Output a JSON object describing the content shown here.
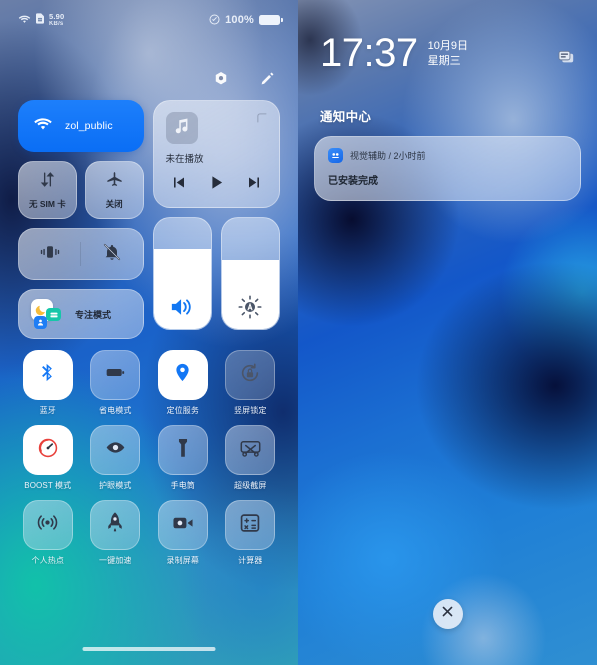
{
  "left_panel": {
    "status_bar": {
      "wifi_icon": "wifi-icon",
      "sim_icon": "sim-card-icon",
      "net_speed_value": "5.90",
      "net_speed_unit": "KB/s",
      "charge_icon": "charge-circle-icon",
      "battery_percent": "100%"
    },
    "tools": {
      "settings_icon": "gear-icon",
      "edit_icon": "pencil-icon"
    },
    "wifi_tile": {
      "icon": "wifi-icon",
      "label": "zol_public",
      "color": "#0a6ef5"
    },
    "sim_tile": {
      "icon": "data-transfer-icon",
      "label": "无 SIM 卡"
    },
    "airplane_tile": {
      "icon": "airplane-icon",
      "label": "关闭"
    },
    "vibrate_tile": {
      "icon": "vibrate-icon"
    },
    "mute_tile": {
      "icon": "bell-slash-icon"
    },
    "focus_tile": {
      "icon": "moon-icon",
      "label": "专注模式"
    },
    "media": {
      "art_icon": "music-note-icon",
      "title": "未在播放",
      "prev_icon": "previous-track-icon",
      "play_icon": "play-icon",
      "next_icon": "next-track-icon",
      "expand_icon": "expand-corner-icon"
    },
    "volume_slider": {
      "icon": "speaker-wave-icon",
      "level_percent": 72,
      "accent": "#1277f2"
    },
    "brightness_slider": {
      "icon": "brightness-auto-icon",
      "level_percent": 62
    },
    "toggles": [
      {
        "label": "蓝牙",
        "icon": "bluetooth-icon",
        "state": "on"
      },
      {
        "label": "省电模式",
        "icon": "battery-saver-icon",
        "state": "off"
      },
      {
        "label": "定位服务",
        "icon": "location-pin-icon",
        "state": "on"
      },
      {
        "label": "竖屏锁定",
        "icon": "rotation-lock-icon",
        "state": "dim"
      },
      {
        "label": "BOOST 模式",
        "icon": "speed-gauge-icon",
        "state": "on"
      },
      {
        "label": "护眼模式",
        "icon": "eye-icon",
        "state": "off"
      },
      {
        "label": "手电筒",
        "icon": "flashlight-icon",
        "state": "off"
      },
      {
        "label": "超级截屏",
        "icon": "super-screenshot-icon",
        "state": "off"
      },
      {
        "label": "个人热点",
        "icon": "hotspot-icon",
        "state": "off"
      },
      {
        "label": "一键加速",
        "icon": "rocket-icon",
        "state": "off"
      },
      {
        "label": "录制屏幕",
        "icon": "video-record-icon",
        "state": "off"
      },
      {
        "label": "计算器",
        "icon": "calculator-icon",
        "state": "off"
      }
    ],
    "home_indicator": "home-indicator"
  },
  "right_panel": {
    "clock": {
      "time": "17:37",
      "date": "10月9日",
      "weekday": "星期三"
    },
    "card_icon": "notification-cards-icon",
    "notification_center_title": "通知中心",
    "notification": {
      "app_icon": "visual-assist-icon",
      "meta": "视觉辅助 / 2小时前",
      "body": "已安装完成"
    },
    "close_button": {
      "icon": "close-x-icon"
    }
  }
}
